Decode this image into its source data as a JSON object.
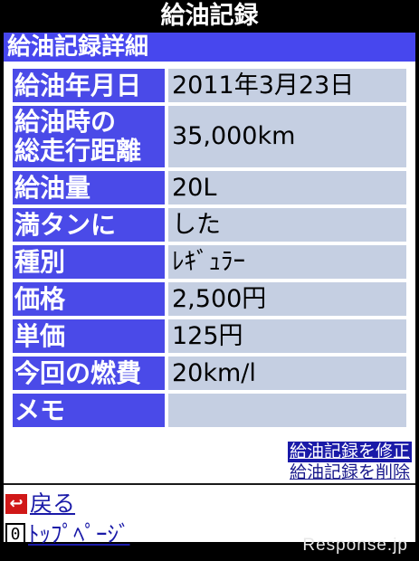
{
  "title": "給油記録",
  "subtitle": "給油記録詳細",
  "records": [
    {
      "label": "給油年月日",
      "value": "2011年3月23日"
    },
    {
      "label": "給油時の\n総走行距離",
      "value": "35,000km"
    },
    {
      "label": "給油量",
      "value": "20L"
    },
    {
      "label": "満タンに",
      "value": "した"
    },
    {
      "label": "種別",
      "value": "ﾚｷﾞｭﾗｰ"
    },
    {
      "label": "価格",
      "value": "2,500円"
    },
    {
      "label": "単価",
      "value": "125円"
    },
    {
      "label": "今回の燃費",
      "value": "20km/l"
    },
    {
      "label": "メモ",
      "value": ""
    }
  ],
  "actions": {
    "edit": "給油記録を修正",
    "delete": "給油記録を削除"
  },
  "nav": {
    "back_icon": "↩",
    "back": "戻る",
    "zero_key": "0",
    "top": "ﾄｯﾌﾟﾍﾟｰｼﾞ"
  },
  "watermark": "Response.jp",
  "colors": {
    "label_bg": "#4a4ae8",
    "value_bg": "#c5cfe2",
    "edit_bg": "#1a1aa8"
  }
}
